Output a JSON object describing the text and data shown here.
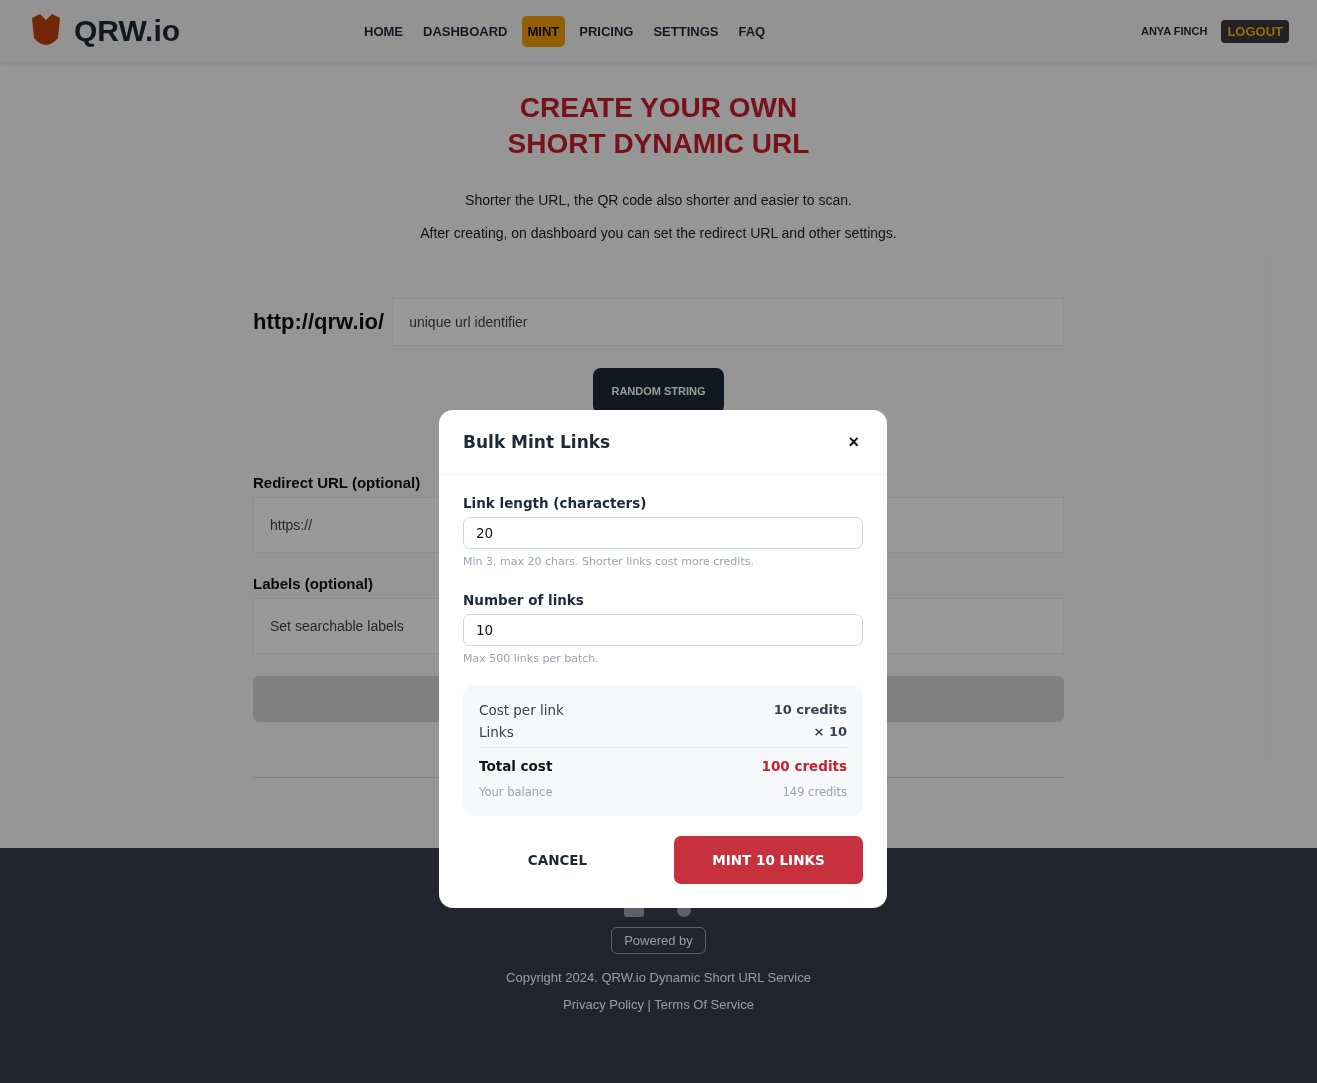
{
  "header": {
    "logo": "QRW.io",
    "nav": [
      {
        "label": "HOME",
        "selected": false
      },
      {
        "label": "DASHBOARD",
        "selected": false
      },
      {
        "label": "MINT",
        "selected": true
      },
      {
        "label": "PRICING",
        "selected": false
      },
      {
        "label": "SETTINGS",
        "selected": false
      },
      {
        "label": "FAQ",
        "selected": false
      }
    ],
    "user": "ANYA FINCH",
    "logout": "LOGOUT"
  },
  "page": {
    "title_lines": [
      "CREATE YOUR OWN",
      "SHORT DYNAMIC URL"
    ],
    "intro": [
      "Shorter the URL, the QR code also shorter and easier to scan.",
      "After creating, on dashboard you can set the redirect URL and other settings."
    ],
    "url_prefix": "http://qrw.io/",
    "identifier": {
      "placeholder": "unique url identifier"
    },
    "random_button": "RANDOM STRING",
    "redirect": {
      "label": "Redirect URL (optional)",
      "placeholder": "https://"
    },
    "labels": {
      "label": "Labels (optional)",
      "placeholder": "Set searchable labels"
    }
  },
  "footer": {
    "powered_by": "Powered by",
    "copyright": "Copyright 2024. QRW.io Dynamic Short URL Service",
    "legal": "Privacy Policy | Terms Of Service"
  },
  "dialog": {
    "title": "Bulk Mint Links",
    "close": "×",
    "fields": [
      {
        "label": "Link length (characters)",
        "value": "20",
        "hint": "Min 3, max 20 chars. Shorter links cost more credits."
      },
      {
        "label": "Number of links",
        "value": "10",
        "hint": "Max 500 links per batch."
      }
    ],
    "summary": [
      {
        "kind": "line",
        "label": "Cost per link",
        "value": "10 credits"
      },
      {
        "kind": "line",
        "label": "Links",
        "value": "× 10"
      },
      {
        "kind": "total",
        "label": "Total cost",
        "value": "100 credits"
      },
      {
        "kind": "muted",
        "label": "Your balance",
        "value": "149 credits"
      }
    ],
    "cancel": "CANCEL",
    "confirm": "MINT 10 LINKS"
  }
}
